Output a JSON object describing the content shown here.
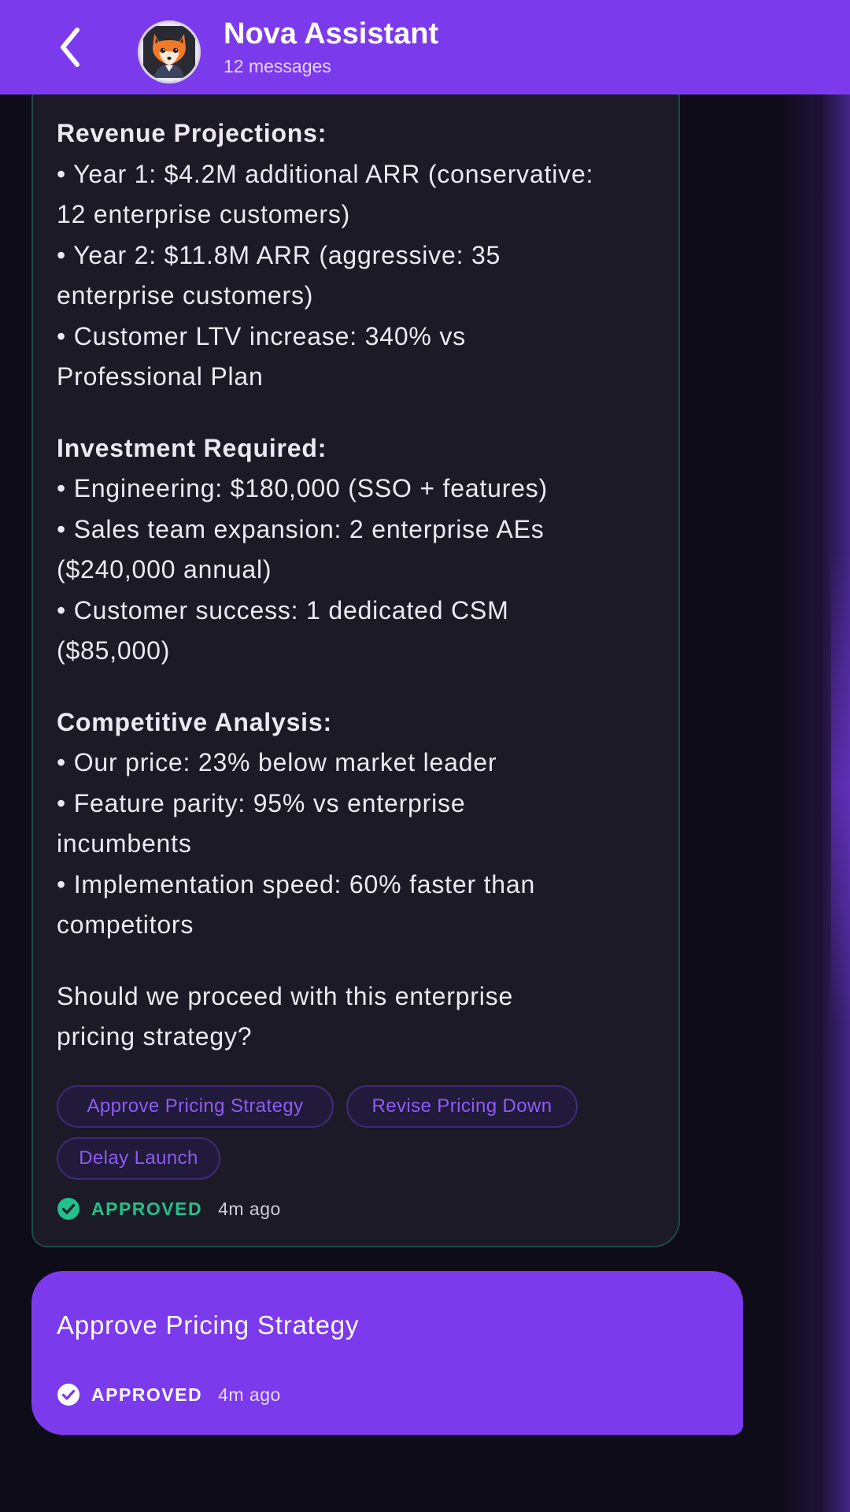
{
  "header": {
    "back_icon": "chevron-left-icon",
    "avatar_icon": "fox-avatar-icon",
    "title": "Nova Assistant",
    "subtitle": "12 messages"
  },
  "assistant_message": {
    "sections": [
      {
        "title": "Revenue Projections:",
        "lines": [
          "• Year 1: $4.2M additional ARR (conservative:",
          "12 enterprise customers)",
          "• Year 2: $11.8M ARR (aggressive: 35",
          "enterprise customers)",
          "• Customer LTV increase: 340% vs",
          "Professional Plan"
        ]
      },
      {
        "title": "Investment Required:",
        "lines": [
          "• Engineering: $180,000 (SSO + features)",
          "• Sales team expansion: 2 enterprise AEs",
          "($240,000 annual)",
          "• Customer success: 1 dedicated CSM",
          "($85,000)"
        ]
      },
      {
        "title": "Competitive Analysis:",
        "lines": [
          "• Our price: 23% below market leader",
          "• Feature parity: 95% vs enterprise",
          "incumbents",
          "• Implementation speed: 60% faster than",
          "competitors"
        ]
      }
    ],
    "question_lines": [
      "Should we proceed with this enterprise",
      "pricing strategy?"
    ],
    "actions": [
      "Approve Pricing Strategy",
      "Revise Pricing Down",
      "Delay Launch"
    ],
    "status": {
      "icon": "check-circle-icon",
      "label": "APPROVED",
      "time": "4m ago",
      "color": "#22c08a"
    }
  },
  "user_message": {
    "text": "Approve Pricing Strategy",
    "status": {
      "icon": "check-circle-icon",
      "label": "APPROVED",
      "time": "4m ago",
      "color": "#ffffff"
    }
  },
  "colors": {
    "accent": "#7c3aed",
    "background": "#0f0c1a",
    "bubble": "#1b1a26",
    "approved_green": "#22c08a"
  }
}
